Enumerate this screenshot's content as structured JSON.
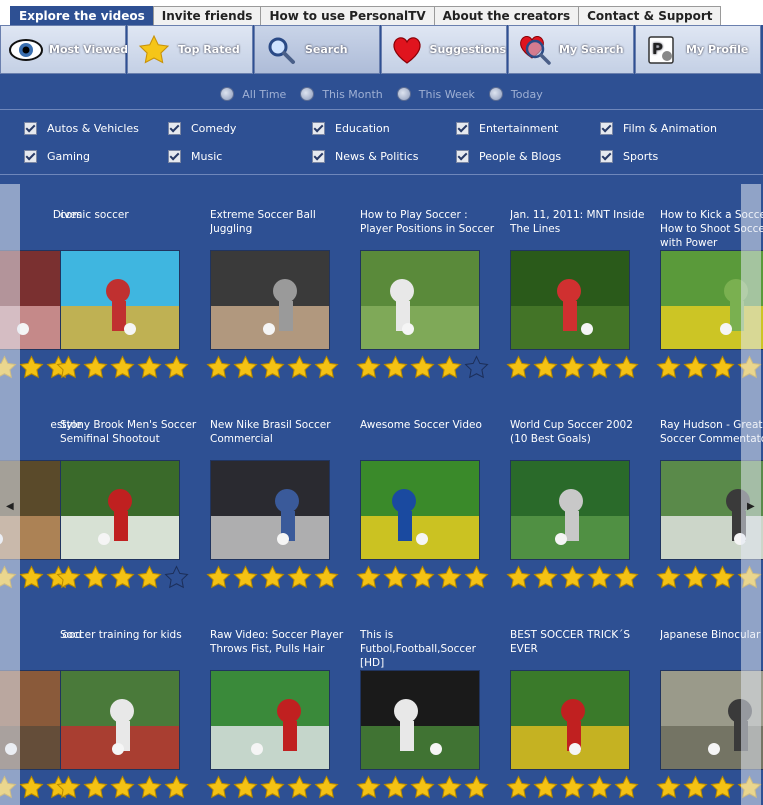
{
  "top_tabs": [
    {
      "label": "Explore the videos",
      "active": true
    },
    {
      "label": "Invite friends",
      "active": false
    },
    {
      "label": "How to use PersonalTV",
      "active": false
    },
    {
      "label": "About the creators",
      "active": false
    },
    {
      "label": "Contact & Support",
      "active": false
    }
  ],
  "nav": [
    {
      "label": "Most Viewed",
      "icon": "eye-icon",
      "active": false
    },
    {
      "label": "Top Rated",
      "icon": "star-icon",
      "active": false
    },
    {
      "label": "Search",
      "icon": "magnifier-icon",
      "active": true
    },
    {
      "label": "Suggestions",
      "icon": "heart-icon",
      "active": false
    },
    {
      "label": "My Search",
      "icon": "heart-magnifier-icon",
      "active": false
    },
    {
      "label": "My Profile",
      "icon": "profile-icon",
      "active": false
    }
  ],
  "time_filters": [
    "All Time",
    "This Month",
    "This Week",
    "Today"
  ],
  "categories": [
    "Autos & Vehicles",
    "Comedy",
    "Education",
    "Entertainment",
    "Film & Animation",
    "Gaming",
    "Music",
    "News & Politics",
    "People & Blogs",
    "Sports"
  ],
  "videos": [
    {
      "title": "Dives",
      "rating": 5,
      "partial": true
    },
    {
      "title": "comic soccer",
      "rating": 5
    },
    {
      "title": "Extreme Soccer Ball Juggling",
      "rating": 5
    },
    {
      "title": "How to Play Soccer : Player Positions in Soccer",
      "rating": 4
    },
    {
      "title": "Jan. 11, 2011: MNT Inside The Lines",
      "rating": 5
    },
    {
      "title": "How to Kick a Soccer Ball : How to Shoot Soccer Ball with Power",
      "rating": 5,
      "partial": true
    },
    {
      "title": "estyle",
      "rating": 5,
      "partial": true
    },
    {
      "title": "Stony Brook Men's Soccer Semifinal Shootout",
      "rating": 4
    },
    {
      "title": "New Nike Brasil Soccer Commercial",
      "rating": 5
    },
    {
      "title": "Awesome Soccer Video",
      "rating": 5
    },
    {
      "title": "World Cup Soccer 2002 (10 Best Goals)",
      "rating": 5
    },
    {
      "title": "Ray Hudson - Greatest Soccer Commentator Ever",
      "rating": 5,
      "partial": true
    },
    {
      "title": "ood",
      "rating": 5,
      "partial": true
    },
    {
      "title": "Soccer training for kids",
      "rating": 5
    },
    {
      "title": "Raw Video: Soccer Player Throws Fist, Pulls Hair",
      "rating": 5
    },
    {
      "title": "This is Futbol,Football,Soccer [HD]",
      "rating": 5
    },
    {
      "title": "BEST SOCCER TRICK´S EVER",
      "rating": 5
    },
    {
      "title": "Japanese Binocular Soccer",
      "rating": 5,
      "partial": true
    }
  ],
  "colors": {
    "panel": "#2e5093",
    "star": "#f4c214",
    "active_tab": "#2e5093"
  }
}
